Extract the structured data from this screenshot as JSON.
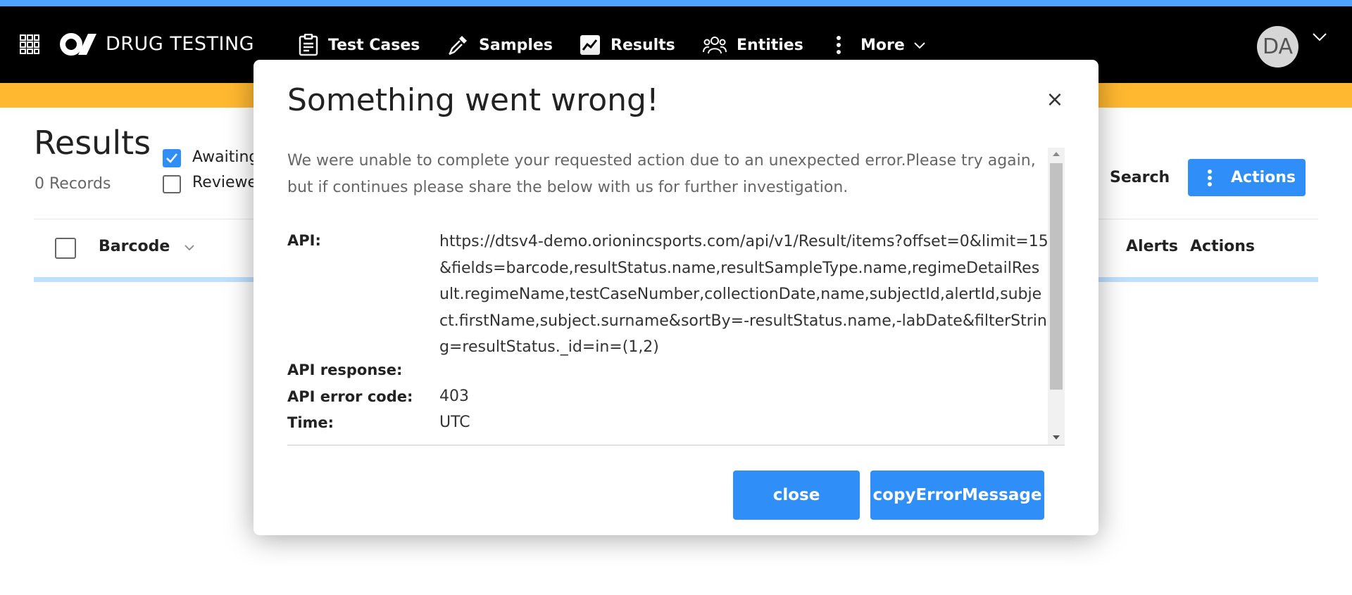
{
  "app": {
    "brand": "DRUG TESTING",
    "logo_text": "O/"
  },
  "nav": {
    "items": [
      {
        "label": "Test Cases",
        "icon": "clipboard-icon"
      },
      {
        "label": "Samples",
        "icon": "pipette-icon"
      },
      {
        "label": "Results",
        "icon": "chart-line-icon"
      },
      {
        "label": "Entities",
        "icon": "users-icon"
      },
      {
        "label": "More",
        "icon": "kebab-icon"
      }
    ],
    "user_initials": "DA"
  },
  "page": {
    "title": "Results",
    "records": "0 Records",
    "filters": [
      {
        "label": "Awaiting",
        "checked": true
      },
      {
        "label": "Reviewe",
        "checked": false
      }
    ],
    "search_label": "Search",
    "actions_label": "Actions",
    "table": {
      "columns": [
        "Barcode",
        "Alerts",
        "Actions"
      ]
    }
  },
  "modal": {
    "title": "Something went wrong!",
    "close_glyph": "×",
    "intro": "We were unable to complete your requested action due to an unexpected error.Please try again, but if continues please share the below with us for further investigation.",
    "rows": [
      {
        "label": "API:",
        "value": "https://dtsv4-demo.orionincsports.com/api/v1/Result/items?offset=0&limit=15&fields=barcode,resultStatus.name,resultSampleType.name,regimeDetailResult.regimeName,testCaseNumber,collectionDate,name,subjectId,alertId,subject.firstName,subject.surname&sortBy=-resultStatus.name,-labDate&filterString=resultStatus._id=in=(1,2)"
      },
      {
        "label": "API response:",
        "value": ""
      },
      {
        "label": "API error code:",
        "value": "403"
      },
      {
        "label": "Time:",
        "value": "UTC"
      }
    ],
    "buttons": {
      "close": "close",
      "copy": "copyErrorMessage"
    }
  },
  "colors": {
    "accent": "#2f8ef8",
    "navbar": "#000000",
    "top_stripe": "#4da3ff",
    "sub_bar": "#ffb830"
  }
}
